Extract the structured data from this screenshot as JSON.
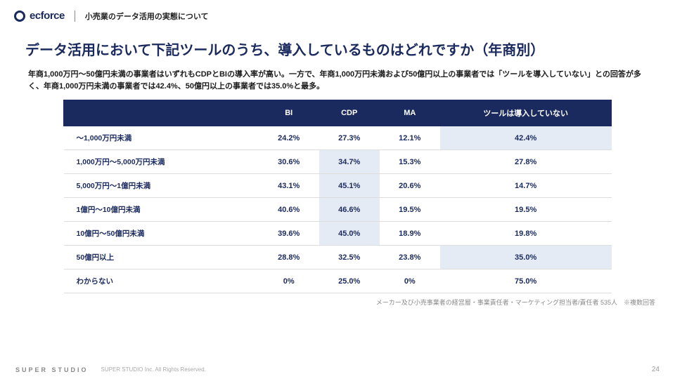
{
  "header": {
    "logo_text": "ecforce",
    "breadcrumb": "小売業のデータ活用の実態について"
  },
  "title": "データ活用において下記ツールのうち、導入しているものはどれですか（年商別）",
  "lead": "年商1,000万円〜50億円未満の事業者はいずれもCDPとBIの導入率が高い。一方で、年商1,000万円未満および50億円以上の事業者では「ツールを導入していない」との回答が多く、年商1,000万円未満の事業者では42.4%、50億円以上の事業者では35.0%と最多。",
  "chart_data": {
    "type": "table",
    "columns": [
      "",
      "BI",
      "CDP",
      "MA",
      "ツールは導入していない"
    ],
    "rows": [
      {
        "label": "〜1,000万円未満",
        "cells": [
          "24.2%",
          "27.3%",
          "12.1%",
          "42.4%"
        ],
        "hl": [
          false,
          false,
          false,
          true
        ]
      },
      {
        "label": "1,000万円〜5,000万円未満",
        "cells": [
          "30.6%",
          "34.7%",
          "15.3%",
          "27.8%"
        ],
        "hl": [
          false,
          true,
          false,
          false
        ]
      },
      {
        "label": "5,000万円〜1億円未満",
        "cells": [
          "43.1%",
          "45.1%",
          "20.6%",
          "14.7%"
        ],
        "hl": [
          false,
          true,
          false,
          false
        ]
      },
      {
        "label": "1億円〜10億円未満",
        "cells": [
          "40.6%",
          "46.6%",
          "19.5%",
          "19.5%"
        ],
        "hl": [
          false,
          true,
          false,
          false
        ]
      },
      {
        "label": "10億円〜50億円未満",
        "cells": [
          "39.6%",
          "45.0%",
          "18.9%",
          "19.8%"
        ],
        "hl": [
          false,
          true,
          false,
          false
        ]
      },
      {
        "label": "50億円以上",
        "cells": [
          "28.8%",
          "32.5%",
          "23.8%",
          "35.0%"
        ],
        "hl": [
          false,
          false,
          false,
          true
        ]
      },
      {
        "label": "わからない",
        "cells": [
          "0%",
          "25.0%",
          "0%",
          "75.0%"
        ],
        "hl": [
          false,
          false,
          false,
          false
        ]
      }
    ]
  },
  "footnote": "メーカー及び小売事業者の経営層・事業責任者・マーケティング担当者/責任者 535人　※複数回答",
  "footer": {
    "studio": "SUPER STUDIO",
    "copyright": "SUPER STUDIO Inc. All Rights Reserved.",
    "page": "24"
  }
}
